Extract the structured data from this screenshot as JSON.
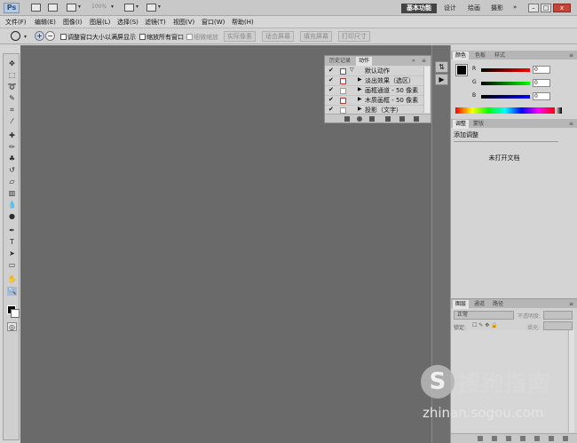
{
  "app": {
    "logo": "Ps"
  },
  "toolbar": {
    "zoom": "100%",
    "workspaces": [
      "基本功能",
      "设计",
      "绘画",
      "摄影"
    ],
    "more": "»",
    "window_min": "–",
    "window_max": "□",
    "window_close": "x"
  },
  "menu": [
    "文件(F)",
    "编辑(E)",
    "图像(I)",
    "图层(L)",
    "选择(S)",
    "滤镜(T)",
    "视图(V)",
    "窗口(W)",
    "帮助(H)"
  ],
  "options": {
    "resize_windows": "调整窗口大小以满屏显示",
    "zoom_all": "缩放所有窗口",
    "scrubby_zoom": "细微缩放",
    "buttons": [
      "实际像素",
      "适合屏幕",
      "填充屏幕",
      "打印尺寸"
    ]
  },
  "actions_panel": {
    "tabs": [
      "历史记录",
      "动作"
    ],
    "rows": [
      {
        "label": "默认动作",
        "level": 0,
        "dialog": true
      },
      {
        "label": "淡出效果（选区）",
        "level": 1,
        "dialog": true
      },
      {
        "label": "画框通道 - 50 像素",
        "level": 1,
        "dialog": false
      },
      {
        "label": "木质画框 - 50 像素",
        "level": 1,
        "dialog": true
      },
      {
        "label": "投影（文字）",
        "level": 1,
        "dialog": false
      }
    ]
  },
  "color_panel": {
    "tabs": [
      "颜色",
      "色板",
      "样式"
    ],
    "channels": [
      {
        "name": "R",
        "value": "0",
        "gradient": "linear-gradient(to right,#000,#f00)"
      },
      {
        "name": "G",
        "value": "0",
        "gradient": "linear-gradient(to right,#000,#0f0)"
      },
      {
        "name": "B",
        "value": "0",
        "gradient": "linear-gradient(to right,#000,#00f)"
      }
    ]
  },
  "adjust_panel": {
    "tabs": [
      "调整",
      "蒙版"
    ],
    "title": "添加调整",
    "message": "未打开文档"
  },
  "layers_panel": {
    "tabs": [
      "图层",
      "通道",
      "路径"
    ],
    "blend_mode": "正常",
    "opacity_label": "不透明度:",
    "lock_label": "锁定:",
    "fill_label": "填充:"
  },
  "watermark": {
    "name": "搜狗指南",
    "url": "zhinan.sogou.com"
  }
}
